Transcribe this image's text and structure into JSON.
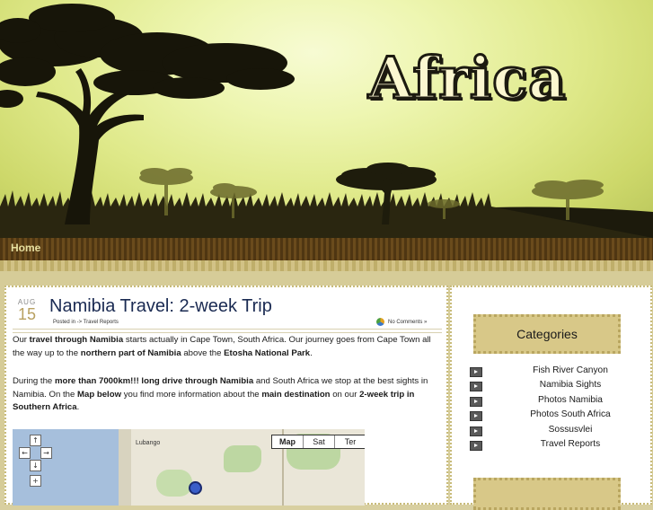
{
  "site": {
    "logo": "Africa"
  },
  "nav": {
    "home": "Home"
  },
  "post": {
    "date_month": "AUG",
    "date_day": "15",
    "title": "Namibia Travel: 2-week Trip",
    "meta": "Posted in -> Travel Reports",
    "comments": "No Comments »",
    "p1_a": "Our ",
    "p1_b": "travel through Namibia",
    "p1_c": " starts actually in Cape Town, South Africa. Our journey goes from Cape Town all the way up to the ",
    "p1_d": "northern part of Namibia",
    "p1_e": " above the ",
    "p1_f": "Etosha National Park",
    "p1_g": ".",
    "p2_a": "During the ",
    "p2_b": "more than 7000km!!! long drive through Namibia",
    "p2_c": " and South Africa we stop at the best sights in Namibia. On the ",
    "p2_d": "Map below",
    "p2_e": " you find more information about the ",
    "p2_f": "main destination",
    "p2_g": " on our ",
    "p2_h": "2-week trip in Southern Africa",
    "p2_i": "."
  },
  "map": {
    "types": [
      "Map",
      "Sat",
      "Ter"
    ],
    "place_label": "Lubango",
    "controls": {
      "up": "↑",
      "left": "←",
      "right": "→",
      "down": "↓",
      "zoom_in": "+"
    }
  },
  "sidebar": {
    "categories_title": "Categories",
    "categories": [
      "Fish River Canyon",
      "Namibia Sights",
      "Photos Namibia",
      "Photos South Africa",
      "Sossusvlei",
      "Travel Reports"
    ]
  },
  "colors": {
    "sky": "#eef6b2",
    "nav_bg": "#5a3e18",
    "title": "#1a2a52",
    "category_box": "#d8c888"
  }
}
